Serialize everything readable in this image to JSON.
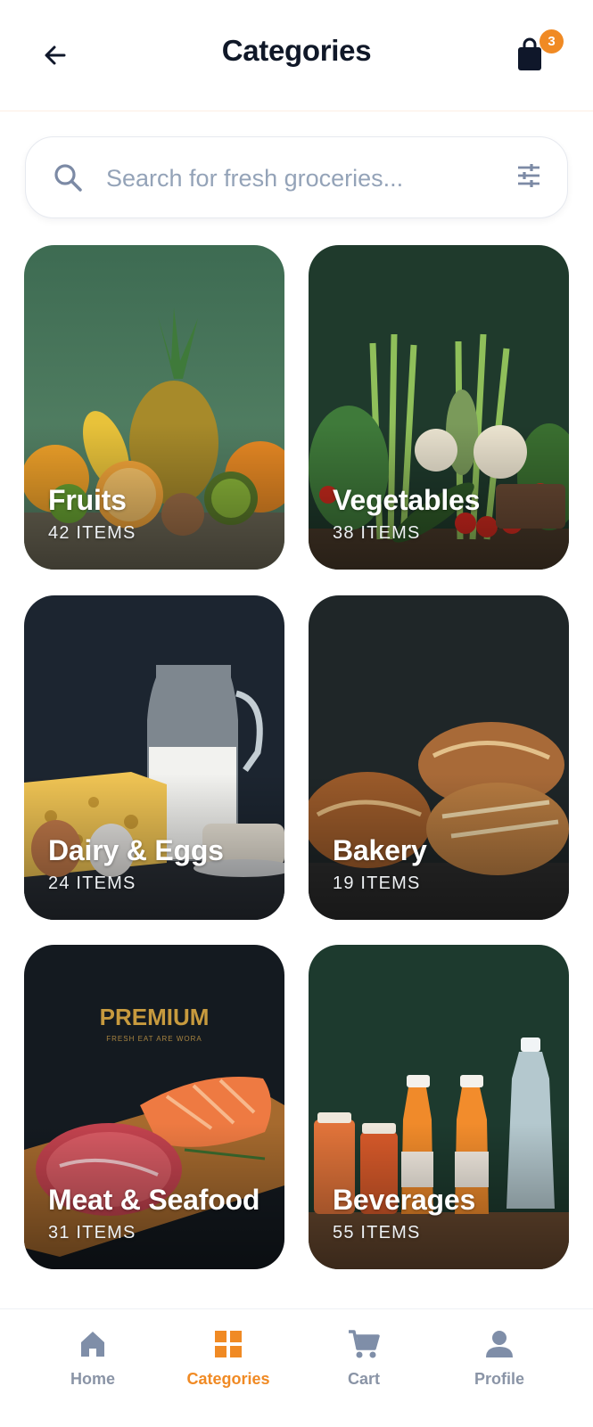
{
  "header": {
    "title": "Categories",
    "cart_badge": "3"
  },
  "search": {
    "placeholder": "Search for fresh groceries..."
  },
  "categories": [
    {
      "name": "Fruits",
      "count": "42 ITEMS"
    },
    {
      "name": "Vegetables",
      "count": "38 ITEMS"
    },
    {
      "name": "Dairy & Eggs",
      "count": "24 ITEMS"
    },
    {
      "name": "Bakery",
      "count": "19 ITEMS"
    },
    {
      "name": "Meat & Seafood",
      "count": "31 ITEMS",
      "logo_text": "PREMIUM",
      "logo_subtext": "FRESH EAT ARE WORA"
    },
    {
      "name": "Beverages",
      "count": "55 ITEMS"
    }
  ],
  "nav": {
    "items": [
      {
        "label": "Home",
        "icon": "home-icon"
      },
      {
        "label": "Categories",
        "icon": "grid-icon",
        "active": true
      },
      {
        "label": "Cart",
        "icon": "cart-icon"
      },
      {
        "label": "Profile",
        "icon": "person-icon"
      }
    ]
  },
  "colors": {
    "accent": "#f08a24",
    "text": "#101828",
    "muted": "#8a94a6",
    "placeholder": "#94a3b8"
  }
}
